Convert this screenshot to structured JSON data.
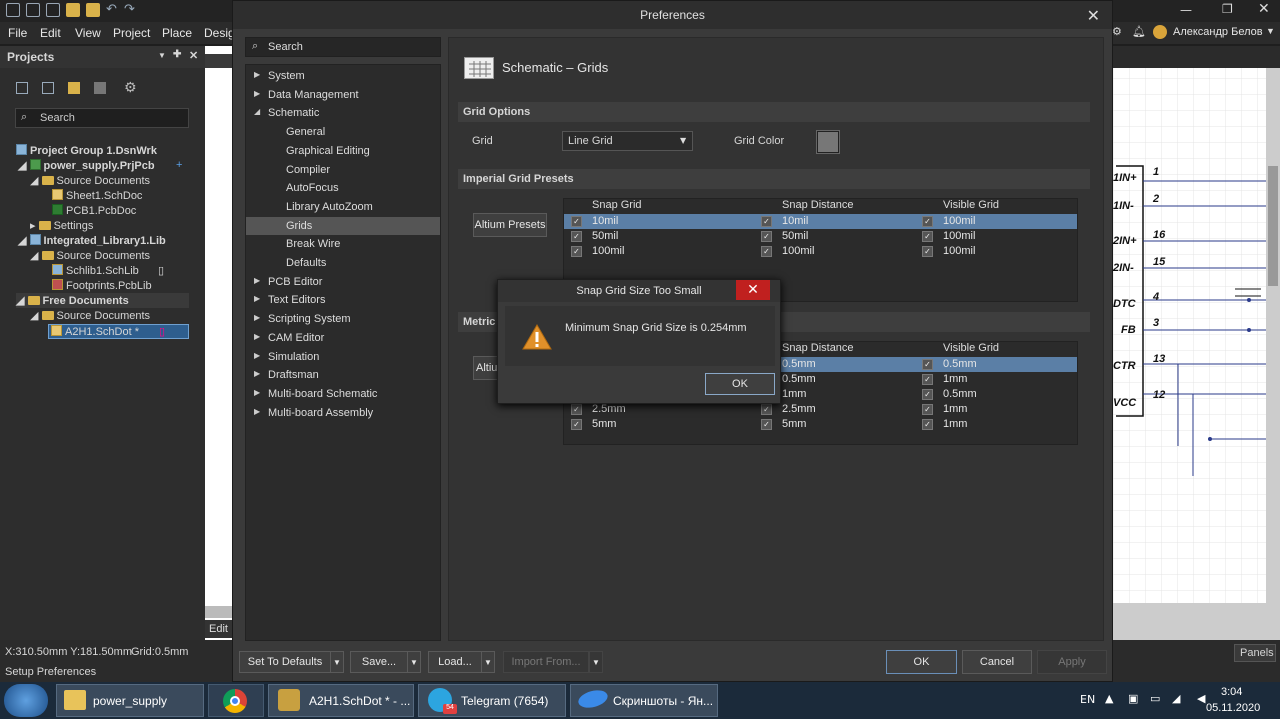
{
  "menubar": {
    "file": "File",
    "edit": "Edit",
    "view": "View",
    "project": "Project",
    "place": "Place",
    "design": "Desig"
  },
  "user": {
    "name": "Александр Белов"
  },
  "projects": {
    "title": "Projects",
    "search_placeholder": "Search",
    "tree": [
      "Project Group 1.DsnWrk",
      "power_supply.PrjPcb",
      "Source Documents",
      "Sheet1.SchDoc",
      "PCB1.PcbDoc",
      "Settings",
      "Integrated_Library1.Lib",
      "Source Documents",
      "Schlib1.SchLib",
      "Footprints.PcbLib",
      "Free Documents",
      "Source Documents",
      "A2H1.SchDot *"
    ]
  },
  "schematic": {
    "pins": [
      {
        "label": "1IN+",
        "num": "1"
      },
      {
        "label": "1IN-",
        "num": "2"
      },
      {
        "label": "2IN+",
        "num": "16"
      },
      {
        "label": "2IN-",
        "num": "15"
      },
      {
        "label": "DTC",
        "num": "4"
      },
      {
        "label": "FB",
        "num": "3"
      },
      {
        "label": "CTR",
        "num": "13"
      },
      {
        "label": "VCC",
        "num": "12"
      }
    ]
  },
  "status": {
    "coords": "X:310.50mm Y:181.50mm",
    "grid": "Grid:0.5mm",
    "hint": "Setup Preferences",
    "panels": "Panels",
    "edit_tab": "Edit"
  },
  "taskbar": {
    "items": [
      "power_supply",
      "A2H1.SchDot * - ...",
      "Telegram (7654)",
      "Скриншоты - Ян..."
    ],
    "telegram_badge": "54",
    "lang": "EN",
    "time": "3:04",
    "date": "05.11.2020"
  },
  "prefs": {
    "title": "Preferences",
    "search": "Search",
    "tree": [
      {
        "label": "System",
        "level": 0,
        "arrow": "▶"
      },
      {
        "label": "Data Management",
        "level": 0,
        "arrow": "▶"
      },
      {
        "label": "Schematic",
        "level": 0,
        "arrow": "◢"
      },
      {
        "label": "General",
        "level": 1
      },
      {
        "label": "Graphical Editing",
        "level": 1
      },
      {
        "label": "Compiler",
        "level": 1
      },
      {
        "label": "AutoFocus",
        "level": 1
      },
      {
        "label": "Library AutoZoom",
        "level": 1
      },
      {
        "label": "Grids",
        "level": 1,
        "selected": true
      },
      {
        "label": "Break Wire",
        "level": 1
      },
      {
        "label": "Defaults",
        "level": 1
      },
      {
        "label": "PCB Editor",
        "level": 0,
        "arrow": "▶"
      },
      {
        "label": "Text Editors",
        "level": 0,
        "arrow": "▶"
      },
      {
        "label": "Scripting System",
        "level": 0,
        "arrow": "▶"
      },
      {
        "label": "CAM Editor",
        "level": 0,
        "arrow": "▶"
      },
      {
        "label": "Simulation",
        "level": 0,
        "arrow": "▶"
      },
      {
        "label": "Draftsman",
        "level": 0,
        "arrow": "▶"
      },
      {
        "label": "Multi-board Schematic",
        "level": 0,
        "arrow": "▶"
      },
      {
        "label": "Multi-board Assembly",
        "level": 0,
        "arrow": "▶"
      }
    ],
    "page_title": "Schematic – Grids",
    "grid_options": {
      "title": "Grid Options",
      "grid_label": "Grid",
      "grid_value": "Line Grid",
      "color_label": "Grid Color",
      "color": "#777777"
    },
    "imperial": {
      "title": "Imperial Grid Presets",
      "button": "Altium Presets",
      "headers": [
        "Snap Grid",
        "Snap Distance",
        "Visible Grid"
      ],
      "rows": [
        [
          "10mil",
          "10mil",
          "100mil"
        ],
        [
          "50mil",
          "50mil",
          "100mil"
        ],
        [
          "100mil",
          "100mil",
          "100mil"
        ]
      ]
    },
    "metric": {
      "title": "Metric",
      "button": "Altiu",
      "headers": [
        "Snap Distance",
        "Visible Grid"
      ],
      "rows": [
        [
          "",
          "0.5mm",
          "0.5mm"
        ],
        [
          "",
          "0.5mm",
          "1mm"
        ],
        [
          "",
          "1mm",
          "0.5mm"
        ],
        [
          "2.5mm",
          "2.5mm",
          "1mm"
        ],
        [
          "5mm",
          "5mm",
          "1mm"
        ]
      ]
    },
    "footer": {
      "set_defaults": "Set To Defaults",
      "save": "Save...",
      "load": "Load...",
      "import": "Import From...",
      "ok": "OK",
      "cancel": "Cancel",
      "apply": "Apply"
    }
  },
  "msgbox": {
    "title": "Snap Grid Size Too Small",
    "message": "Minimum Snap Grid Size is 0.254mm",
    "ok": "OK",
    "close": "✕"
  }
}
